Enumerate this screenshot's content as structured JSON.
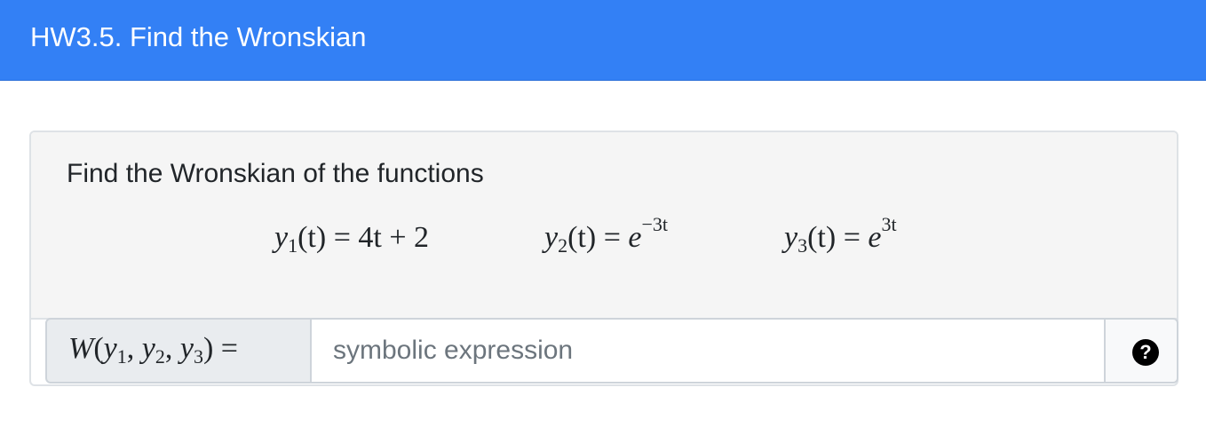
{
  "header": {
    "title": "HW3.5. Find the Wronskian"
  },
  "question": {
    "prompt": "Find the Wronskian of the functions",
    "functions": [
      {
        "name": "y",
        "sub": "1",
        "arg": "(t)",
        "eq": " = ",
        "expr": "4t + 2",
        "sup": ""
      },
      {
        "name": "y",
        "sub": "2",
        "arg": "(t)",
        "eq": " = ",
        "expr": "e",
        "sup": "−3t"
      },
      {
        "name": "y",
        "sub": "3",
        "arg": "(t)",
        "eq": " = ",
        "expr": "e",
        "sup": "3t"
      }
    ]
  },
  "answer": {
    "label": {
      "W": "W",
      "open": "(",
      "y1": "y",
      "s1": "1",
      "c1": ", ",
      "y2": "y",
      "s2": "2",
      "c2": ", ",
      "y3": "y",
      "s3": "3",
      "close": ")",
      "eq": " ="
    },
    "placeholder": "symbolic expression",
    "value": ""
  },
  "help": {
    "icon": "question-circle-icon",
    "glyph": "?"
  }
}
